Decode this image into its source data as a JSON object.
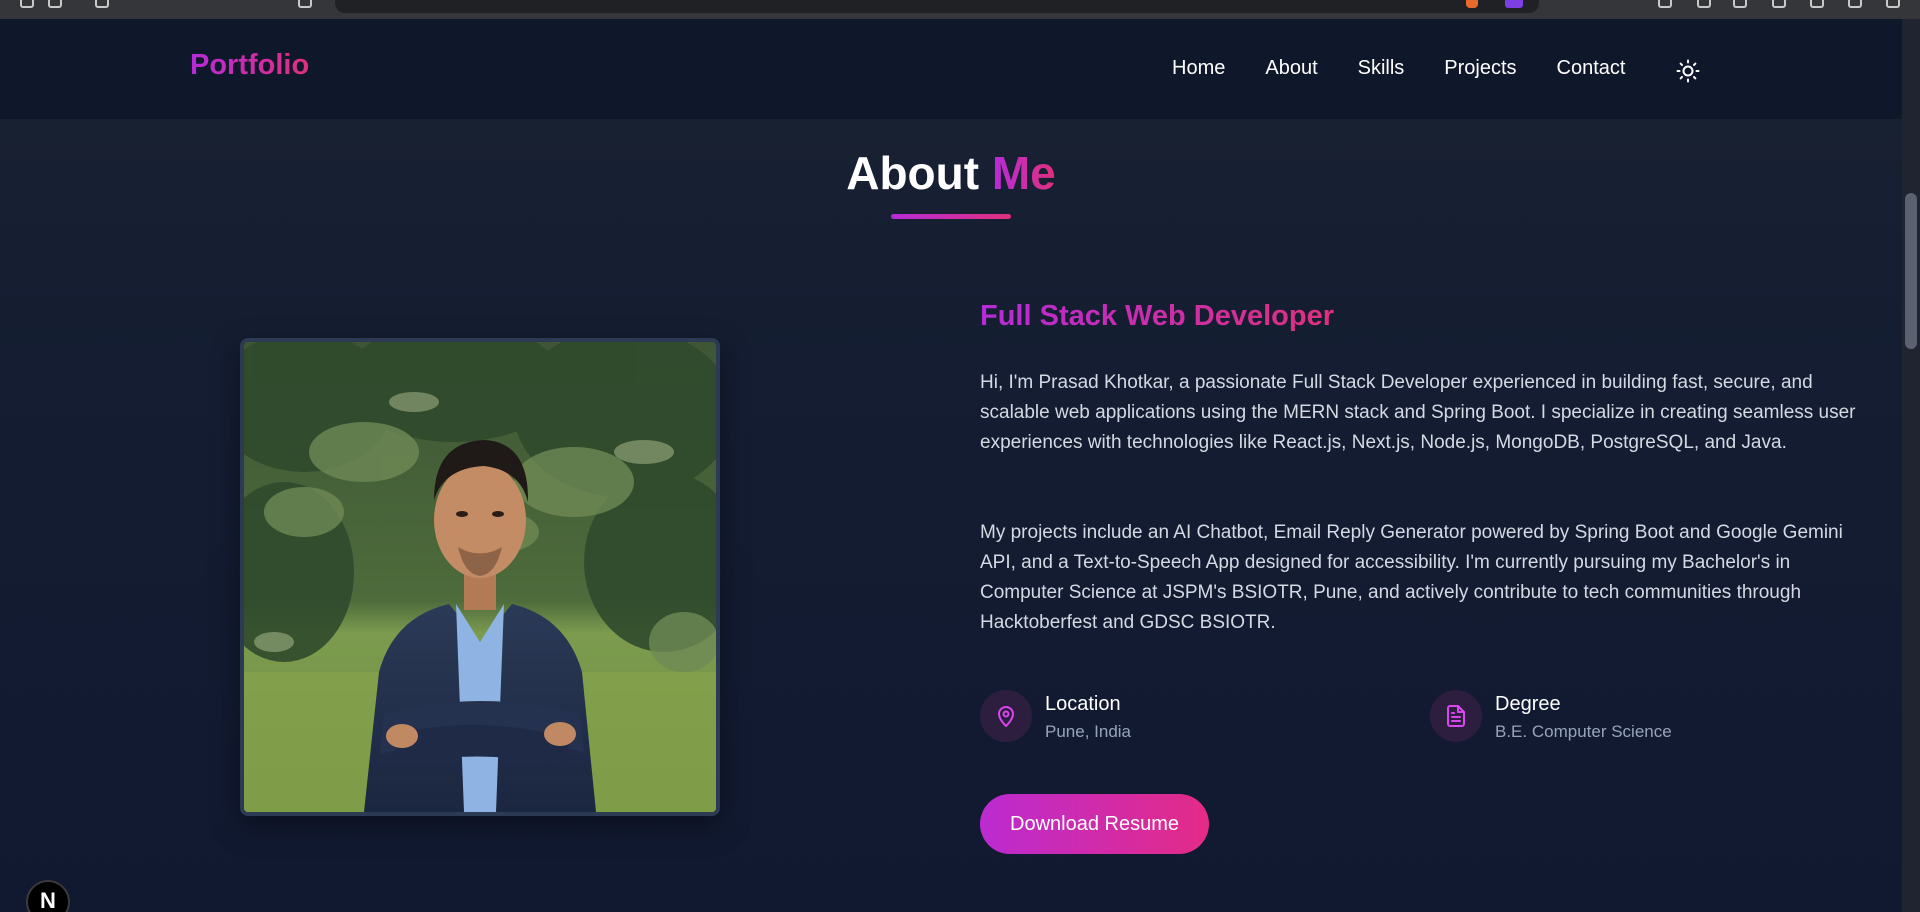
{
  "navbar": {
    "brand": "Portfolio",
    "links": [
      "Home",
      "About",
      "Skills",
      "Projects",
      "Contact"
    ],
    "theme_toggle_icon": "sun-icon"
  },
  "about": {
    "title_main": "About",
    "title_accent": "Me",
    "role": "Full Stack Web Developer",
    "bio_paragraphs": [
      "Hi, I'm Prasad Khotkar, a passionate Full Stack Developer experienced in building fast, secure, and scalable web applications using the MERN stack and Spring Boot. I specialize in creating seamless user experiences with technologies like React.js, Next.js, Node.js, MongoDB, PostgreSQL, and Java.",
      "My projects include an AI Chatbot, Email Reply Generator powered by Spring Boot and Google Gemini API, and a Text-to-Speech App designed for accessibility. I'm currently pursuing my Bachelor's in Computer Science at JSPM's BSIOTR, Pune, and actively contribute to tech communities through Hacktoberfest and GDSC BSIOTR."
    ],
    "info": {
      "location": {
        "label": "Location",
        "value": "Pune, India",
        "icon": "map-pin-icon"
      },
      "degree": {
        "label": "Degree",
        "value": "B.E. Computer Science",
        "icon": "document-icon"
      }
    },
    "download_button": "Download Resume"
  },
  "next_badge": "N",
  "colors": {
    "accent_start": "#b62bd9",
    "accent_end": "#e0307c",
    "background": "#141d31",
    "navbar": "#0f172a"
  }
}
